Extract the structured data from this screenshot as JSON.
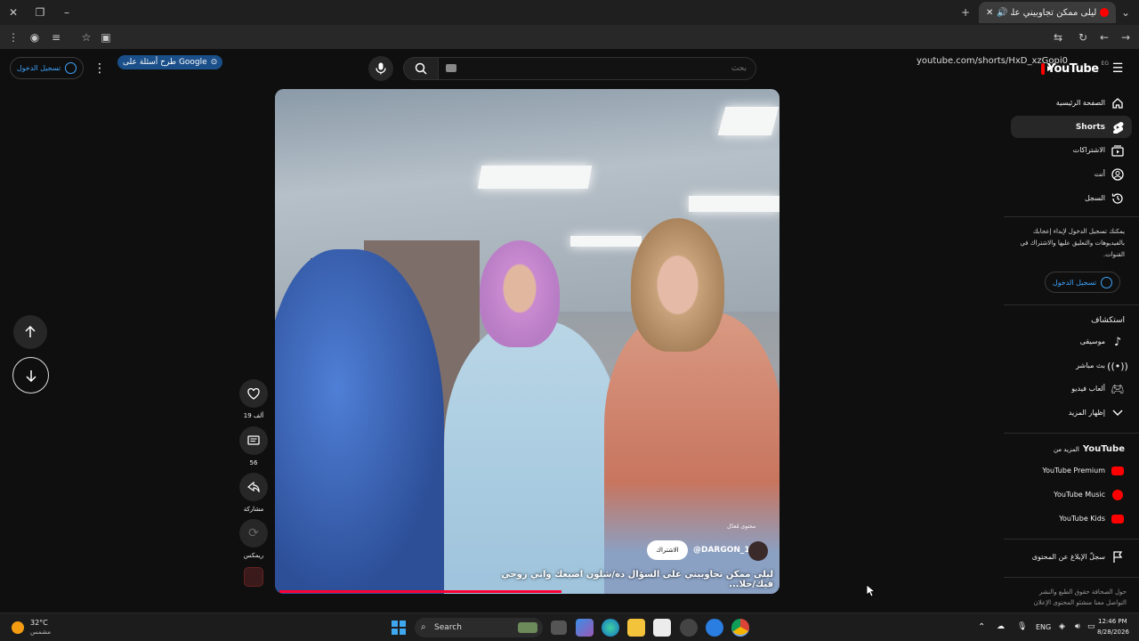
{
  "browser": {
    "tab_title": "ليلى ممكن تجاوبيني على الـ",
    "google_pill": "طرح أسئلة على Google",
    "url": "youtube.com/shorts/HxD_xzGopi0"
  },
  "header": {
    "logo_text": "YouTube",
    "logo_region": "EG",
    "search_placeholder": "بحث",
    "signin_label": "تسجيل الدخول"
  },
  "sidebar": {
    "items": [
      {
        "label": "الصفحة الرئيسية",
        "icon": "home-icon"
      },
      {
        "label": "Shorts",
        "icon": "shorts-icon"
      },
      {
        "label": "الاشتراكات",
        "icon": "subscriptions-icon"
      },
      {
        "label": "أنت",
        "icon": "account-icon"
      },
      {
        "label": "السجل",
        "icon": "history-icon"
      }
    ],
    "signin_note": "يمكنك تسجيل الدخول لإبداء إعجابك بالفيديوهات والتعليق عليها والاشتراك في القنوات.",
    "signin_label": "تسجيل الدخول",
    "explore_heading": "استكشاف",
    "explore_items": [
      {
        "label": "موسيقى",
        "icon": "music-icon"
      },
      {
        "label": "بث مباشر",
        "icon": "live-icon"
      },
      {
        "label": "ألعاب فيديو",
        "icon": "gaming-icon"
      },
      {
        "label": "إظهار المزيد",
        "icon": "chevron-down-icon"
      }
    ],
    "more_heading_prefix": "المزيد من",
    "more_heading_brand": "YouTube",
    "more_items": [
      {
        "label": "YouTube Premium"
      },
      {
        "label": "YouTube Music"
      },
      {
        "label": "YouTube Kids"
      }
    ],
    "report_label": "سجلّ الإبلاغ عن المحتوى",
    "footer_line1": "حول  الصحافة  حقوق الطبع والنشر",
    "footer_line2": "التواصل معنا  منشئو المحتوى  الإعلان"
  },
  "video": {
    "caption": "ليلى ممكن تجاوبيني على السؤال ده/شلون اضيعك واني روحي فيك/حلا...",
    "handle": "@DARGON_1",
    "subscribe_label": "الاشتراك",
    "badge": "محتوى مُعدّل",
    "progress": 0.57
  },
  "actions": [
    {
      "name": "like",
      "count": "19 ألف",
      "icon": "heart-icon"
    },
    {
      "name": "comment",
      "count": "56",
      "icon": "comment-icon"
    },
    {
      "name": "share",
      "count": "مشاركة",
      "icon": "share-icon"
    },
    {
      "name": "remix",
      "count": "ريمكس",
      "icon": "remix-icon"
    }
  ],
  "taskbar": {
    "weather_temp": "32°C",
    "weather_desc": "مشمس",
    "search_label": "Search",
    "lang": "ENG",
    "time": "12:46 PM",
    "date": "8/28/2026"
  }
}
